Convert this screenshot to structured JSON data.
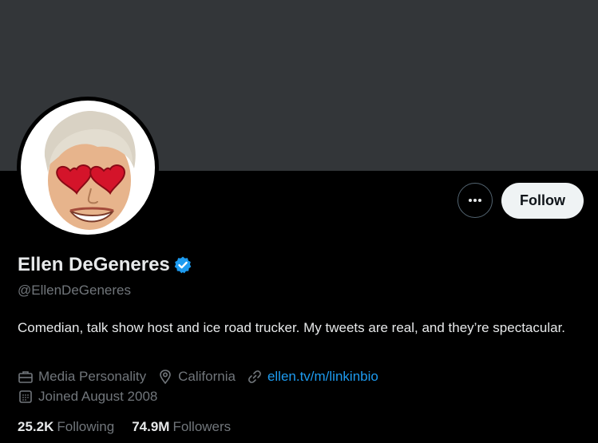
{
  "profile": {
    "display_name": "Ellen DeGeneres",
    "handle": "@EllenDeGeneres",
    "bio": "Comedian, talk show host and ice road trucker. My tweets are real, and they’re spectacular.",
    "category": "Media Personality",
    "location": "California",
    "website": "ellen.tv/m/linkinbio",
    "joined": "Joined August 2008"
  },
  "stats": {
    "following_count": "25.2K",
    "following_label": "Following",
    "followers_count": "74.9M",
    "followers_label": "Followers"
  },
  "actions": {
    "follow_label": "Follow",
    "more_icon": "more-horizontal-icon"
  },
  "icons": {
    "verified": "verified-badge-icon",
    "category": "briefcase-icon",
    "location": "location-pin-icon",
    "website": "link-icon",
    "joined": "calendar-icon"
  },
  "colors": {
    "background": "#000000",
    "banner": "#333639",
    "accent": "#1d9bf0",
    "text_primary": "#e7e9ea",
    "text_secondary": "#71767b",
    "follow_bg": "#eff3f4"
  }
}
